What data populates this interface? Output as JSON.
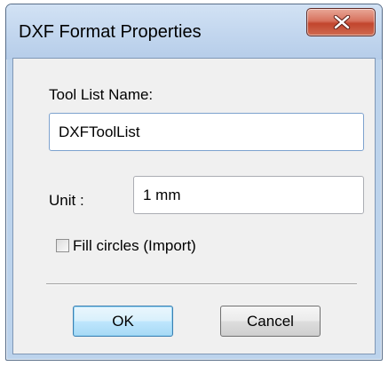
{
  "window": {
    "title": "DXF Format Properties",
    "close_icon": "close-x-icon"
  },
  "form": {
    "tool_list_label": "Tool List Name:",
    "tool_list_value": "DXFToolList",
    "unit_label": "Unit :",
    "unit_value": "1 mm",
    "fill_circles_label": "Fill circles (Import)",
    "fill_circles_checked": false
  },
  "buttons": {
    "ok_label": "OK",
    "cancel_label": "Cancel"
  },
  "colors": {
    "frame": "#bcd3ec",
    "close_button": "#c2452d",
    "default_button_border": "#3c7fb1",
    "client_bg": "#f0f0f0"
  }
}
